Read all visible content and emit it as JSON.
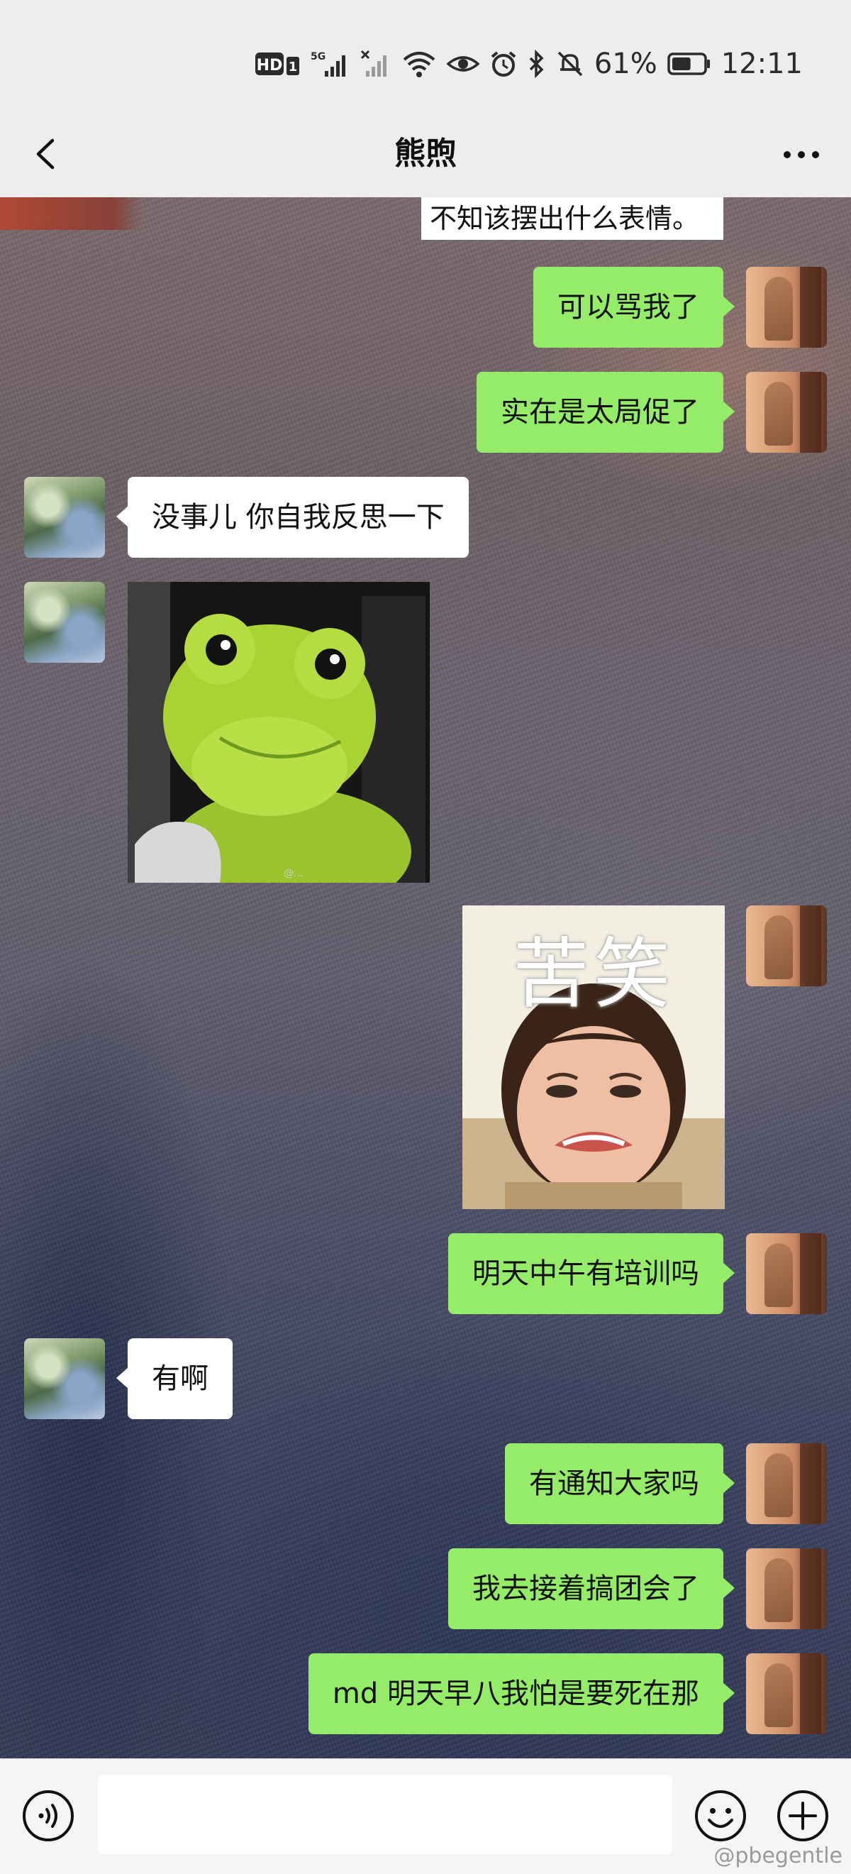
{
  "status_bar": {
    "hd_label": "HD",
    "sim_label": "1",
    "network_label": "5G",
    "battery_percent": "61%",
    "battery_level": 0.61,
    "time": "12:11"
  },
  "header": {
    "title": "熊煦"
  },
  "messages": {
    "partial": "不知该摆出什么表情。",
    "m1": "可以骂我了",
    "m2": "实在是太局促了",
    "m3": "没事儿  你自我反思一下",
    "sticker_frog_watermark": "@...",
    "sticker_crying_caption": "苦笑",
    "m4": "明天中午有培训吗",
    "m5": "有啊",
    "m6": "有通知大家吗",
    "m7": "我去接着搞团会了",
    "m8": "md 明天早八我怕是要死在那"
  },
  "input_bar": {
    "placeholder": ""
  },
  "watermark": "@pbegentle",
  "colors": {
    "outgoing_bubble": "#95ec69",
    "incoming_bubble": "#ffffff",
    "header_bg": "#ededed"
  }
}
